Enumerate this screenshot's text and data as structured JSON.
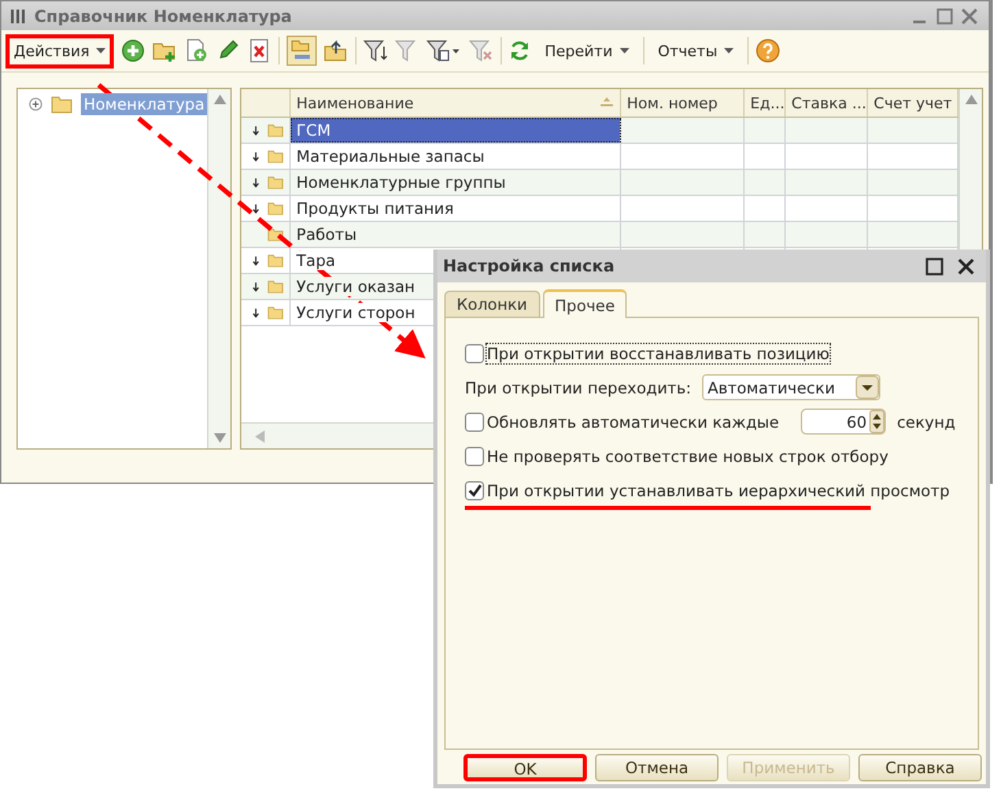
{
  "window": {
    "title": "Справочник Номенклатура"
  },
  "toolbar": {
    "actions_menu": {
      "label": "Действия",
      "highlighted": true
    },
    "goto_menu": {
      "label": "Перейти"
    },
    "reports_menu": {
      "label": "Отчеты"
    }
  },
  "tree": {
    "items": [
      {
        "label": "Номенклатура",
        "selected": true,
        "expanded": false
      }
    ]
  },
  "table": {
    "columns": [
      "Наименование",
      "Ном. номер",
      "Ед...",
      "Ставка ...",
      "Счет учет"
    ],
    "rows": [
      {
        "name": "ГСМ",
        "selected": true,
        "expandable": true
      },
      {
        "name": "Материальные запасы",
        "selected": false,
        "expandable": true
      },
      {
        "name": "Номенклатурные группы",
        "selected": false,
        "expandable": true
      },
      {
        "name": "Продукты питания",
        "selected": false,
        "expandable": true
      },
      {
        "name": "Работы",
        "selected": false,
        "expandable": false
      },
      {
        "name": "Тара",
        "selected": false,
        "expandable": true
      },
      {
        "name": "Услуги оказан",
        "selected": false,
        "expandable": true
      },
      {
        "name": "Услуги сторон",
        "selected": false,
        "expandable": true
      }
    ]
  },
  "dialog": {
    "title": "Настройка списка",
    "tabs": [
      {
        "label": "Колонки",
        "selected": false
      },
      {
        "label": "Прочее",
        "selected": true
      }
    ],
    "options": [
      {
        "kind": "checkbox",
        "label": "При открытии восстанавливать позицию",
        "checked": false,
        "underlined": false
      },
      {
        "kind": "select",
        "label": "При открытии переходить:",
        "value": "Автоматически"
      },
      {
        "kind": "spin",
        "label": "Обновлять автоматически каждые",
        "checked": false,
        "value": "60",
        "unit": "секунд"
      },
      {
        "kind": "checkbox",
        "label": "Не проверять соответствие новых строк отбору",
        "checked": false,
        "underlined": false
      },
      {
        "kind": "checkbox",
        "label": "При открытии устанавливать иерархический просмотр",
        "checked": true,
        "underlined": true
      }
    ],
    "buttons": [
      {
        "label": "OK",
        "disabled": false,
        "highlighted": true
      },
      {
        "label": "Отмена",
        "disabled": false,
        "highlighted": false
      },
      {
        "label": "Применить",
        "disabled": true,
        "highlighted": false
      },
      {
        "label": "Справка",
        "disabled": false,
        "highlighted": false
      }
    ]
  }
}
